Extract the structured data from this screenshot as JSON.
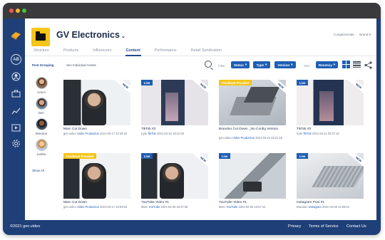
{
  "window_dots": [
    "#ee5a52",
    "#f5b731",
    "#45c13a"
  ],
  "brand": {
    "name": "GV Electronics",
    "company_label": "Conglomerate",
    "brand_label": "Brand"
  },
  "tabs": [
    {
      "label": "Structure"
    },
    {
      "label": "Products"
    },
    {
      "label": "Influencers"
    },
    {
      "label": "Content"
    },
    {
      "label": "Performance"
    },
    {
      "label": "Retail Syndication"
    }
  ],
  "active_tab": "Content",
  "view": {
    "grouping": "Post Grouping",
    "individual": "See Individual Assets"
  },
  "filters": {
    "filter_label": "Filter",
    "status": "Status",
    "type": "Type",
    "version": "Version",
    "sort_label": "Sort",
    "recency": "Recency"
  },
  "sidebar_avatar": "AB",
  "people": [
    {
      "name": "Acacn"
    },
    {
      "name": "Ben"
    },
    {
      "name": "Brandon"
    },
    {
      "name": "Justine"
    }
  ],
  "show_all": "Show All",
  "cards": [
    {
      "badge": "",
      "new": "NEW",
      "title": "Marc Cut Down",
      "by": "gen.video",
      "category": "Video Production",
      "date": "2021-03-17 22:30:15"
    },
    {
      "badge": "Live",
      "new": "NEW",
      "title": "TikTok #3",
      "by": "Kyle",
      "category": "TikTok",
      "date": "2021-03-16 19:12:05"
    },
    {
      "badge": "Feedback Provided",
      "new": "NEW",
      "title": "Brandon Cut Down _No Config Version",
      "by": "gen.video",
      "category": "Video Production",
      "date": "2021-03-24 23:21:10"
    },
    {
      "badge": "Live",
      "new": "NEW",
      "title": "TikTok #2",
      "by": "Kyle",
      "category": "TikTok",
      "date": "2021-03-11 20:37:16"
    },
    {
      "badge": "Feedback Provided",
      "new": "",
      "title": "Marc Cut Down",
      "by": "gen.video",
      "category": "Video Production",
      "date": "2021-03-17 10:09:03"
    },
    {
      "badge": "Live",
      "new": "NEW",
      "title": "YouTube Video #1",
      "by": "Marc",
      "category": "YouTube",
      "date": "2021-03-08 18:37:36"
    },
    {
      "badge": "Live",
      "new": "",
      "title": "YouTube Video #1",
      "by": "Marc",
      "category": "YouTube",
      "date": "2021-02-08 10:57:12"
    },
    {
      "badge": "Live",
      "new": "NEW",
      "title": "Instagram Post #1",
      "by": "Brandon",
      "category": "Instagram",
      "date": "2021-03-08 14:06:01"
    }
  ],
  "footer": {
    "copyright": "©2021 gen.video",
    "privacy": "Privacy",
    "terms": "Terms of Service",
    "contact": "Contact Us"
  },
  "colors": {
    "navy": "#1f3f78",
    "accent": "#1f5eb4",
    "yellow": "#f5c518"
  }
}
